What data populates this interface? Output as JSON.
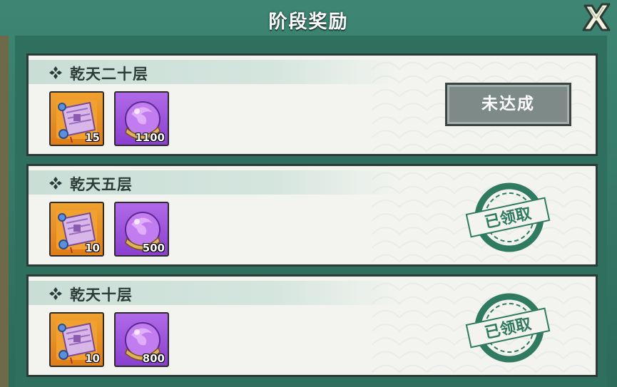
{
  "dialog": {
    "title": "阶段奖励",
    "close_icon": "close-x-icon"
  },
  "colors": {
    "frame": "#2f6e60",
    "card": "#f3f4f0",
    "stamp": "#2f7a61",
    "button": "#7e8a87"
  },
  "rewards": [
    {
      "name": "乾天二十层",
      "status": "未达成",
      "claimed": false,
      "items": [
        {
          "icon": "scroll-icon",
          "qty": "15"
        },
        {
          "icon": "purple-orb-icon",
          "qty": "1100"
        }
      ]
    },
    {
      "name": "乾天五层",
      "status": "已领取",
      "claimed": true,
      "items": [
        {
          "icon": "scroll-icon",
          "qty": "10"
        },
        {
          "icon": "purple-orb-icon",
          "qty": "500"
        }
      ]
    },
    {
      "name": "乾天十层",
      "status": "已领取",
      "claimed": true,
      "items": [
        {
          "icon": "scroll-icon",
          "qty": "10"
        },
        {
          "icon": "purple-orb-icon",
          "qty": "800"
        }
      ]
    }
  ]
}
